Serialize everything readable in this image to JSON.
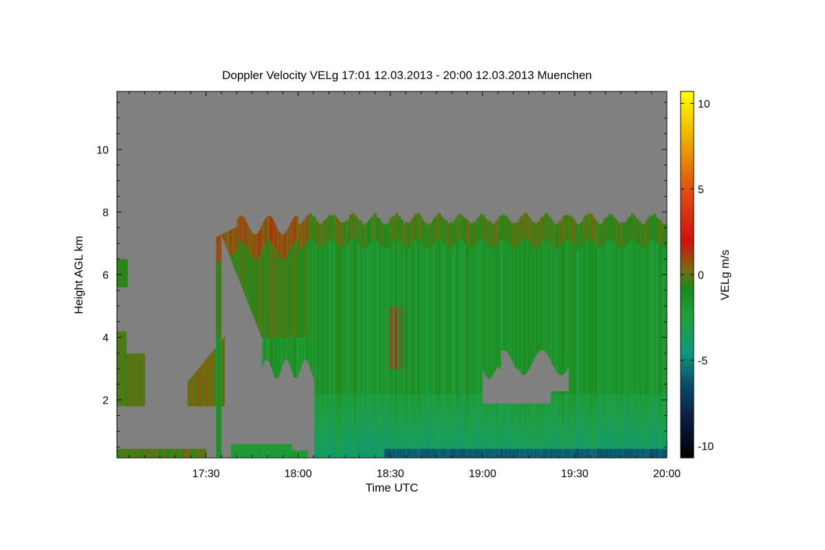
{
  "chart_data": {
    "type": "heatmap",
    "title": "Doppler Velocity VELg   17:01 12.03.2013 - 20:00 12.03.2013 Muenchen",
    "xlabel": "Time UTC",
    "ylabel": "Height AGL km",
    "colorbar_label": "VELg m/s",
    "x_start": "17:01",
    "x_end": "20:00",
    "xlim_minutes_utc": [
      1021,
      1200
    ],
    "xticks": [
      {
        "label": "17:30",
        "minute": 1050
      },
      {
        "label": "18:00",
        "minute": 1080
      },
      {
        "label": "18:30",
        "minute": 1110
      },
      {
        "label": "19:00",
        "minute": 1140
      },
      {
        "label": "19:30",
        "minute": 1170
      },
      {
        "label": "20:00",
        "minute": 1200
      }
    ],
    "ylim": [
      0.15,
      11.85
    ],
    "yticks": [
      {
        "label": "2",
        "value": 2
      },
      {
        "label": "4",
        "value": 4
      },
      {
        "label": "6",
        "value": 6
      },
      {
        "label": "8",
        "value": 8
      },
      {
        "label": "10",
        "value": 10
      }
    ],
    "colorbar_range": [
      -10.7,
      10.7
    ],
    "colorbar_ticks": [
      {
        "label": "10",
        "value": 10
      },
      {
        "label": "5",
        "value": 5
      },
      {
        "label": "0",
        "value": 0
      },
      {
        "label": "-5",
        "value": -5
      },
      {
        "label": "-10",
        "value": -10
      }
    ],
    "colormap": [
      {
        "v": -10.7,
        "color": "#000000"
      },
      {
        "v": -8.5,
        "color": "#0a1a40"
      },
      {
        "v": -6.5,
        "color": "#0a4a6a"
      },
      {
        "v": -4.5,
        "color": "#0e9a7a"
      },
      {
        "v": -2.5,
        "color": "#22a040"
      },
      {
        "v": -0.8,
        "color": "#1a8a1a"
      },
      {
        "v": 0.3,
        "color": "#7a6a10"
      },
      {
        "v": 2.0,
        "color": "#d01010"
      },
      {
        "v": 5.0,
        "color": "#e05010"
      },
      {
        "v": 8.0,
        "color": "#f0b000"
      },
      {
        "v": 10.7,
        "color": "#ffff00"
      }
    ],
    "background_color": "#808080",
    "echo_regions": [
      {
        "region": "main cloud 17:53-20:00",
        "height_km": [
          0.2,
          8.0
        ],
        "velocity_ms_typical": -1.5
      },
      {
        "region": "cloud top 18:00-18:18",
        "height_km": [
          4.0,
          7.8
        ],
        "velocity_ms_typical": 0.5
      },
      {
        "region": "low layer 17:01-17:22",
        "height_km": [
          1.8,
          4.2
        ],
        "velocity_ms_typical": -1.0
      },
      {
        "region": "upper patch 17:01-17:09",
        "height_km": [
          5.6,
          6.5
        ],
        "velocity_ms_typical": -1.0
      },
      {
        "region": "near-ground fallstreak 17:55-18:25",
        "height_km": [
          0.2,
          2.5
        ],
        "velocity_ms_typical": -3.5
      },
      {
        "region": "surface band 18:30-20:00",
        "height_km": [
          0.2,
          0.4
        ],
        "velocity_ms_typical": -7.0
      }
    ]
  }
}
